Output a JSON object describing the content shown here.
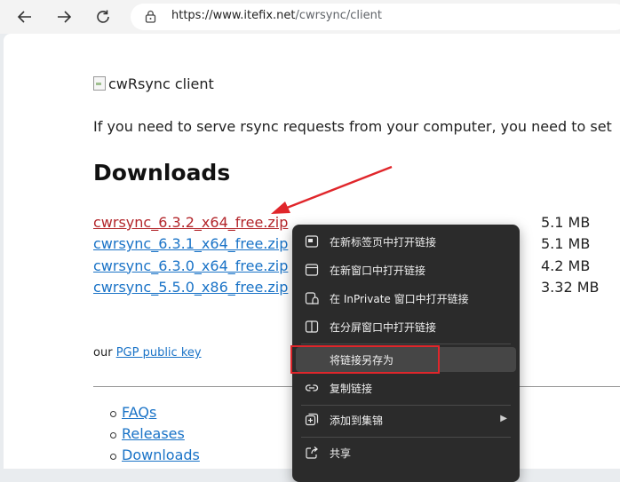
{
  "browser": {
    "url_host": "https://www.itefix.net",
    "url_path": "/cwrsync/client"
  },
  "page": {
    "image_alt": "cwRsync client",
    "intro": "If you need to serve rsync requests from your computer, you need to set",
    "heading": "Downloads",
    "downloads": [
      {
        "name": "cwrsync_6.3.2_x64_free.zip",
        "size": "5.1 MB"
      },
      {
        "name": "cwrsync_6.3.1_x64_free.zip",
        "size": "5.1 MB"
      },
      {
        "name": "cwrsync_6.3.0_x64_free.zip",
        "size": "4.2 MB"
      },
      {
        "name": "cwrsync_5.5.0_x86_free.zip",
        "size": "3.32 MB"
      }
    ],
    "pgp_prefix": "our",
    "pgp_link": "PGP public key",
    "links": [
      "FAQs",
      "Releases",
      "Downloads"
    ]
  },
  "context_menu": {
    "items": [
      {
        "label": "在新标签页中打开链接",
        "icon": "new-tab-icon"
      },
      {
        "label": "在新窗口中打开链接",
        "icon": "new-window-icon"
      },
      {
        "label": "在 InPrivate 窗口中打开链接",
        "icon": "inprivate-icon"
      },
      {
        "label": "在分屏窗口中打开链接",
        "icon": "split-screen-icon"
      },
      {
        "label": "将链接另存为",
        "icon": ""
      },
      {
        "label": "复制链接",
        "icon": "link-icon"
      },
      {
        "label": "添加到集锦",
        "icon": "collections-icon"
      },
      {
        "label": "共享",
        "icon": "share-icon"
      }
    ]
  },
  "colors": {
    "link": "#1a73c7",
    "visited_link": "#b3262b",
    "annotation_red": "#e0262b",
    "menu_bg": "#2b2b2b"
  }
}
